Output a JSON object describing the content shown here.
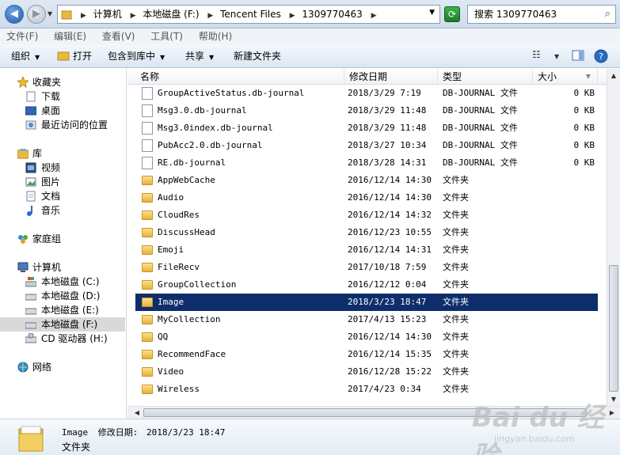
{
  "address": {
    "crumbs": [
      "计算机",
      "本地磁盘 (F:)",
      "Tencent Files",
      "1309770463"
    ],
    "search_placeholder": "搜索 1309770463"
  },
  "menu": [
    "文件(F)",
    "编辑(E)",
    "查看(V)",
    "工具(T)",
    "帮助(H)"
  ],
  "toolbar": {
    "organize": "组织",
    "open": "打开",
    "include": "包含到库中",
    "share": "共享",
    "new_folder": "新建文件夹"
  },
  "nav": {
    "favorites": "收藏夹",
    "downloads": "下载",
    "desktop": "桌面",
    "recent": "最近访问的位置",
    "libraries": "库",
    "videos": "视频",
    "pictures": "图片",
    "documents": "文档",
    "music": "音乐",
    "homegroup": "家庭组",
    "computer": "计算机",
    "drive_c": "本地磁盘 (C:)",
    "drive_d": "本地磁盘 (D:)",
    "drive_e": "本地磁盘 (E:)",
    "drive_f": "本地磁盘 (F:)",
    "drive_h": "CD 驱动器 (H:)",
    "network": "网络"
  },
  "columns": {
    "name": "名称",
    "date": "修改日期",
    "type": "类型",
    "size": "大小"
  },
  "rows": [
    {
      "name": "GroupActiveStatus.db-journal",
      "date": "2018/3/29 7:19",
      "type": "DB-JOURNAL 文件",
      "size": "0 KB",
      "kind": "file"
    },
    {
      "name": "Msg3.0.db-journal",
      "date": "2018/3/29 11:48",
      "type": "DB-JOURNAL 文件",
      "size": "0 KB",
      "kind": "file"
    },
    {
      "name": "Msg3.0index.db-journal",
      "date": "2018/3/29 11:48",
      "type": "DB-JOURNAL 文件",
      "size": "0 KB",
      "kind": "file"
    },
    {
      "name": "PubAcc2.0.db-journal",
      "date": "2018/3/27 10:34",
      "type": "DB-JOURNAL 文件",
      "size": "0 KB",
      "kind": "file"
    },
    {
      "name": "RE.db-journal",
      "date": "2018/3/28 14:31",
      "type": "DB-JOURNAL 文件",
      "size": "0 KB",
      "kind": "file"
    },
    {
      "name": "AppWebCache",
      "date": "2016/12/14 14:30",
      "type": "文件夹",
      "size": "",
      "kind": "folder"
    },
    {
      "name": "Audio",
      "date": "2016/12/14 14:30",
      "type": "文件夹",
      "size": "",
      "kind": "folder"
    },
    {
      "name": "CloudRes",
      "date": "2016/12/14 14:32",
      "type": "文件夹",
      "size": "",
      "kind": "folder"
    },
    {
      "name": "DiscussHead",
      "date": "2016/12/23 10:55",
      "type": "文件夹",
      "size": "",
      "kind": "folder"
    },
    {
      "name": "Emoji",
      "date": "2016/12/14 14:31",
      "type": "文件夹",
      "size": "",
      "kind": "folder"
    },
    {
      "name": "FileRecv",
      "date": "2017/10/18 7:59",
      "type": "文件夹",
      "size": "",
      "kind": "folder"
    },
    {
      "name": "GroupCollection",
      "date": "2016/12/12 0:04",
      "type": "文件夹",
      "size": "",
      "kind": "folder"
    },
    {
      "name": "Image",
      "date": "2018/3/23 18:47",
      "type": "文件夹",
      "size": "",
      "kind": "folder",
      "selected": true
    },
    {
      "name": "MyCollection",
      "date": "2017/4/13 15:23",
      "type": "文件夹",
      "size": "",
      "kind": "folder"
    },
    {
      "name": "QQ",
      "date": "2016/12/14 14:30",
      "type": "文件夹",
      "size": "",
      "kind": "folder"
    },
    {
      "name": "RecommendFace",
      "date": "2016/12/14 15:35",
      "type": "文件夹",
      "size": "",
      "kind": "folder"
    },
    {
      "name": "Video",
      "date": "2016/12/28 15:22",
      "type": "文件夹",
      "size": "",
      "kind": "folder"
    },
    {
      "name": "Wireless",
      "date": "2017/4/23 0:34",
      "type": "文件夹",
      "size": "",
      "kind": "folder"
    }
  ],
  "details": {
    "name": "Image",
    "date_label": "修改日期:",
    "date": "2018/3/23 18:47",
    "type": "文件夹"
  },
  "watermark": {
    "brand": "Bai du 经验",
    "url": "jingyan.baidu.com"
  },
  "colors": {
    "selection": "#0e2e6b",
    "folder": "#e5b23a"
  }
}
